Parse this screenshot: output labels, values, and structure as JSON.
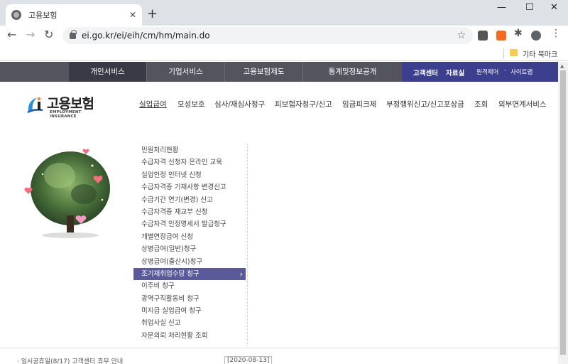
{
  "browser": {
    "tab_title": "고용보험",
    "tab_close": "✕",
    "new_tab": "+",
    "url": "ei.go.kr/ei/eih/cm/hm/main.do",
    "bookmark_folder": "기타 북마크",
    "window_controls": {
      "minimize": "—",
      "maximize": "☐",
      "close": "✕"
    }
  },
  "gnb": {
    "items": [
      "개인서비스",
      "기업서비스",
      "고용보험제도",
      "통계및정보공개"
    ],
    "util": {
      "customer_center": "고객센터",
      "archive": "자료실",
      "remote": "원격제어",
      "dot": "·",
      "sitemap": "사이트맵"
    }
  },
  "logo": {
    "text": "고용보험",
    "sub": "EMPLOYMENT INSURANCE"
  },
  "lnb": {
    "items": [
      "실업급여",
      "모성보호",
      "심사/재심사청구",
      "피보험자청구/신고",
      "임금피크제",
      "부정행위신고/신고포상금",
      "조회",
      "외부연계서비스"
    ]
  },
  "submenu": {
    "items": [
      "민원처리현황",
      "수급자격 신청자 온라인 교육",
      "실업인정 인터넷 신청",
      "수급자격증 기재사항 변경신고",
      "수급기간 연기(변경) 신고",
      "수급자격증 재교부 신청",
      "수급자격 인정명세서 발급청구",
      "개별연장급여 신청",
      "상병급여(일반)청구",
      "상병급여(출산시)청구",
      "조기재취업수당 청구",
      "이주비 청구",
      "광역구직활동비 청구",
      "미지급 실업급여 청구",
      "취업사실 신고",
      "자문의뢰 처리현황 조회"
    ]
  },
  "bottom": {
    "notice": "· 임시공휴일(8/17) 고객센터 휴무 안내",
    "date": "[2020-08-13]"
  },
  "colors": {
    "gnb_bg": "#54545f",
    "util_bg": "#3c3f8d",
    "active_sub": "#5a5a9a"
  }
}
